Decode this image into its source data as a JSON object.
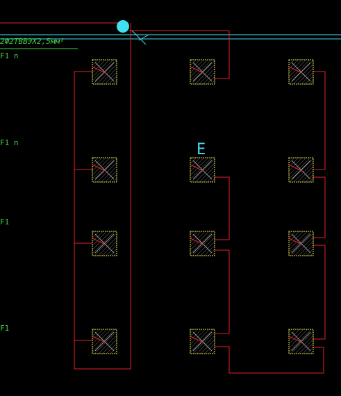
{
  "drawing": {
    "background": "#000000",
    "colors": {
      "wire": "#e8202a",
      "fixture": "#e6e04a",
      "annotation": "#40d040",
      "cyan": "#40e0f0"
    },
    "annotation_text": "2Ф2ТВВЭХ2,5мм²",
    "row_labels": [
      "F1 n",
      "F1 n",
      "F1",
      "F1"
    ],
    "grid_marker": "E",
    "fixtures": {
      "columns": 3,
      "rows": 4,
      "symbol": "ceiling-light-fixture"
    },
    "junction": "cable-entry-point"
  }
}
